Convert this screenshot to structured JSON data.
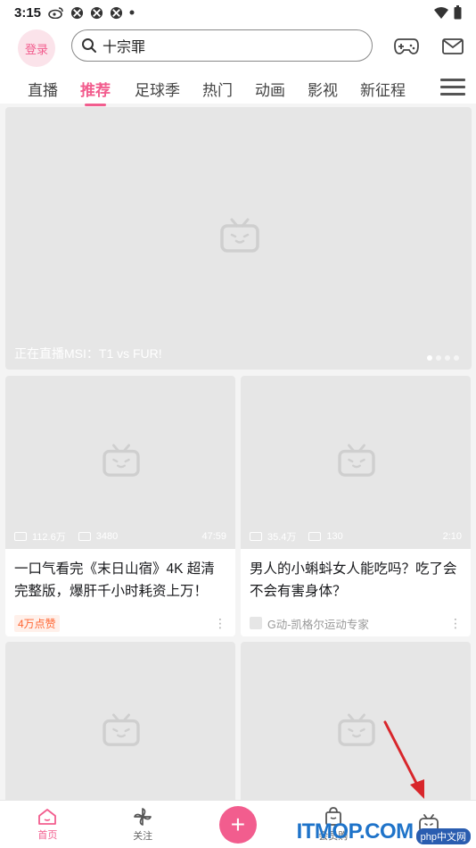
{
  "status_bar": {
    "time": "3:15",
    "icons": [
      "weibo-icon",
      "app-icon",
      "app-icon",
      "app-icon",
      "dot-icon"
    ],
    "right_icons": [
      "wifi-icon",
      "battery-icon"
    ]
  },
  "header": {
    "login_label": "登录",
    "search_text": "十宗罪",
    "right_icons": [
      "game-icon",
      "mail-icon"
    ]
  },
  "tabs": [
    {
      "label": "直播"
    },
    {
      "label": "推荐",
      "active": true
    },
    {
      "label": "足球季"
    },
    {
      "label": "热门"
    },
    {
      "label": "动画"
    },
    {
      "label": "影视"
    },
    {
      "label": "新征程"
    }
  ],
  "banner": {
    "title": "正在直播MSI：T1 vs FUR!"
  },
  "cards": [
    {
      "views": "112.6万",
      "comments": "3480",
      "duration": "47:59",
      "title": "一口气看完《末日山宿》4K 超清完整版，爆肝千小时耗资上万！",
      "likes_badge": "4万点赞",
      "author": ""
    },
    {
      "views": "35.4万",
      "comments": "130",
      "duration": "2:10",
      "title": "男人的小蝌蚪女人能吃吗？吃了会不会有害身体？",
      "likes_badge": "",
      "author": "G动-凯格尔运动专家"
    }
  ],
  "bottom_nav": {
    "home": "首页",
    "follow": "关注",
    "add": "+",
    "vip": "会员购",
    "mine": ""
  },
  "watermark": {
    "main": "ITMOP.COM",
    "sub": "php中文网"
  },
  "colors": {
    "accent": "#f25d8e",
    "placeholder": "#e6e6e6",
    "likes_badge": "#ff6633",
    "annotation_arrow": "#d8262b"
  }
}
